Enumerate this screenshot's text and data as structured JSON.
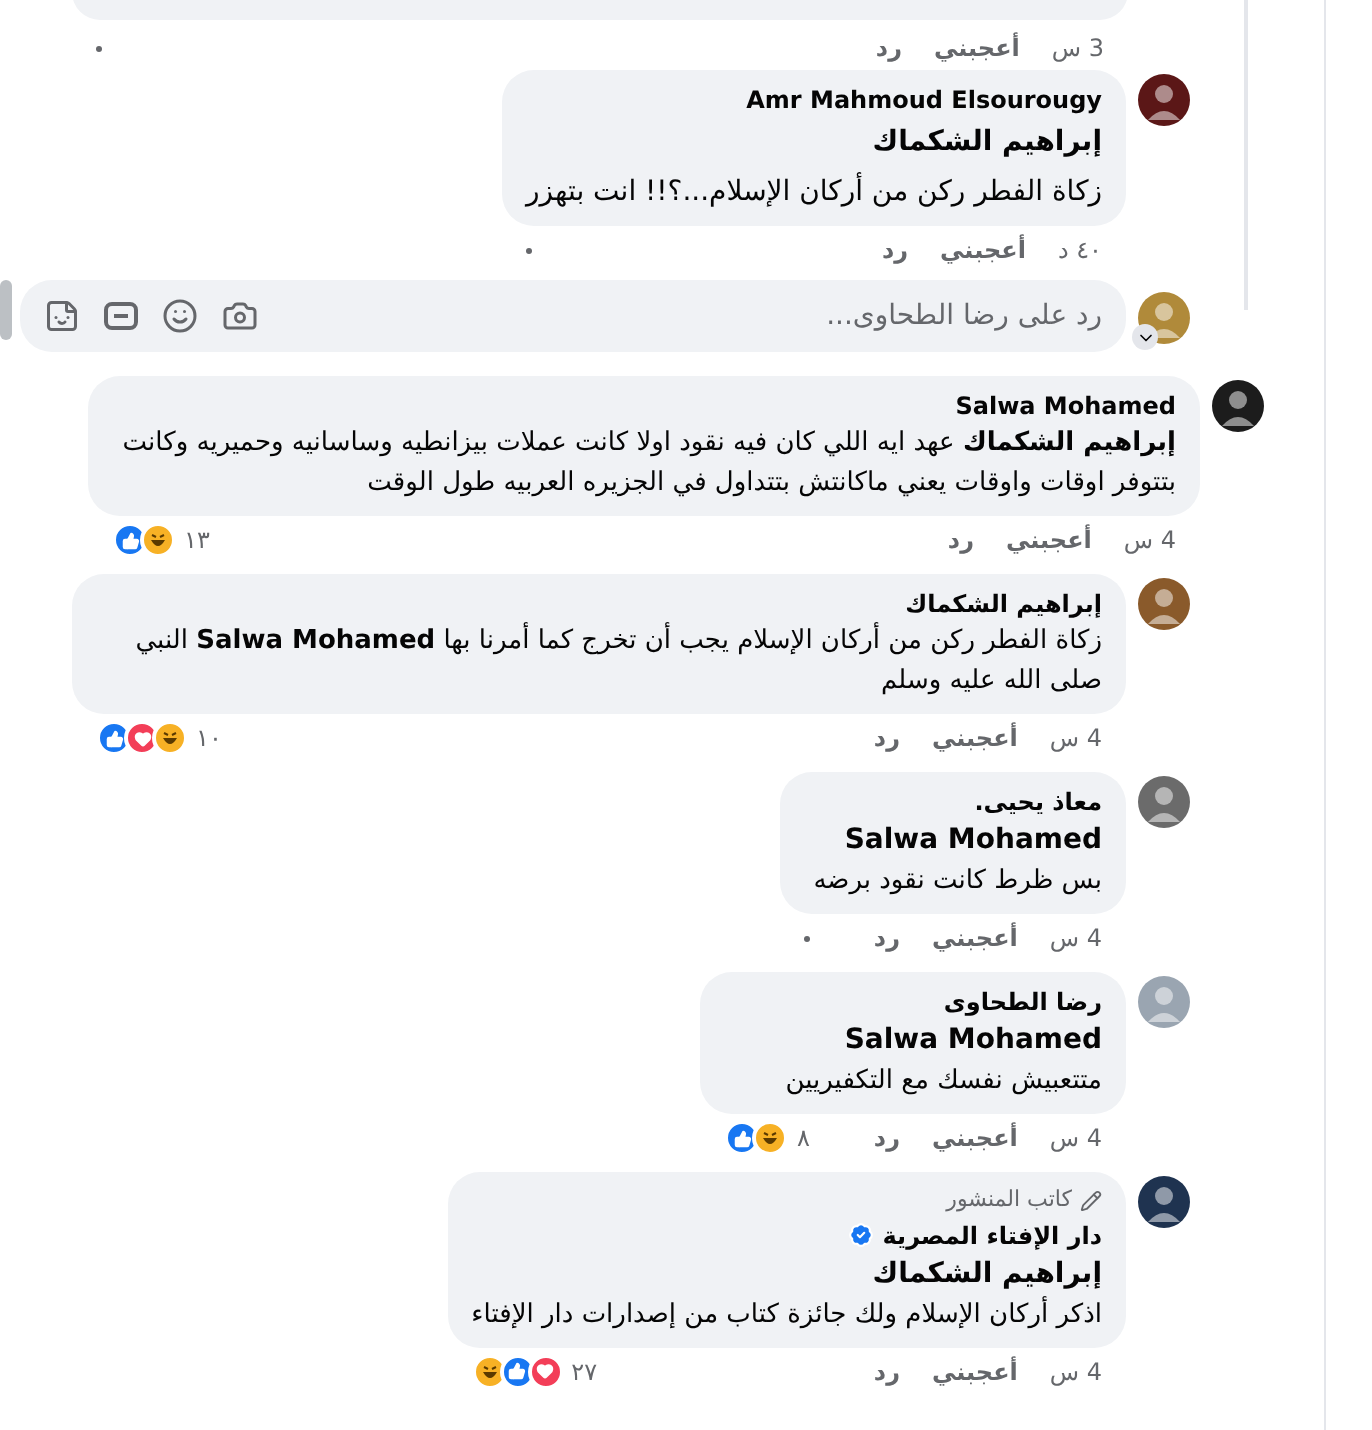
{
  "top_comment": {
    "time": "3 س",
    "like": "أعجبني",
    "reply": "رد",
    "dot": true
  },
  "first_reply": {
    "author": "Amr Mahmoud Elsourougy",
    "mention": "إبراهيم الشكماك",
    "text": "زكاة الفطر ركن من أركان الإسلام...؟!! انت بتهزر",
    "time": "٤٠ د",
    "like": "أعجبني",
    "reply": "رد",
    "dot": true
  },
  "reply_box": {
    "placeholder": "رد على رضا الطحاوى..."
  },
  "comments": [
    {
      "nested": false,
      "verified": false,
      "author": "Salwa Mohamed",
      "text": "**إبراهيم الشكماك** عهد ايه اللي كان فيه نقود اولا كانت عملات بيزانطيه وساسانيه وحميريه وكانت بتتوفر اوقات واوقات يعني ماكانتش بتتداول في الجزيره العربيه طول الوقت",
      "time": "4 س",
      "like": "أعجبني",
      "reply": "رد",
      "reactions": [
        {
          "kind": "like"
        },
        {
          "kind": "haha"
        }
      ],
      "reaction_count": "١٣",
      "dot": false
    },
    {
      "nested": true,
      "verified": false,
      "author": "إبراهيم الشكماك",
      "text": "زكاة الفطر ركن من أركان الإسلام يجب أن تخرج كما أمرنا بها **Salwa Mohamed** النبي صلى الله عليه وسلم",
      "time": "4 س",
      "like": "أعجبني",
      "reply": "رد",
      "reactions": [
        {
          "kind": "like"
        },
        {
          "kind": "love"
        },
        {
          "kind": "haha"
        }
      ],
      "reaction_count": "١٠",
      "dot": false
    },
    {
      "nested": true,
      "verified": false,
      "author": "معاذ يحيى.",
      "mention": "Salwa Mohamed",
      "text": "بس ظرط كانت نقود برضه",
      "time": "4 س",
      "like": "أعجبني",
      "reply": "رد",
      "dot": true
    },
    {
      "nested": true,
      "verified": false,
      "author": "رضا الطحاوى",
      "mention": "Salwa Mohamed",
      "text": "متتعبيش نفسك مع التكفيريين",
      "time": "4 س",
      "like": "أعجبني",
      "reply": "رد",
      "reactions": [
        {
          "kind": "like"
        },
        {
          "kind": "haha"
        }
      ],
      "reaction_count": "٨",
      "dot": false
    },
    {
      "nested": true,
      "badge": "كاتب المنشور",
      "author": "دار الإفتاء المصرية",
      "verified": true,
      "mention": "إبراهيم الشكماك",
      "text": "اذكر أركان الإسلام ولك جائزة كتاب من إصدارات دار الإفتاء",
      "time": "4 س",
      "like": "أعجبني",
      "reply": "رد",
      "reactions": [
        {
          "kind": "haha"
        },
        {
          "kind": "like"
        },
        {
          "kind": "love"
        }
      ],
      "reaction_count": "٢٧",
      "dot": false
    }
  ]
}
